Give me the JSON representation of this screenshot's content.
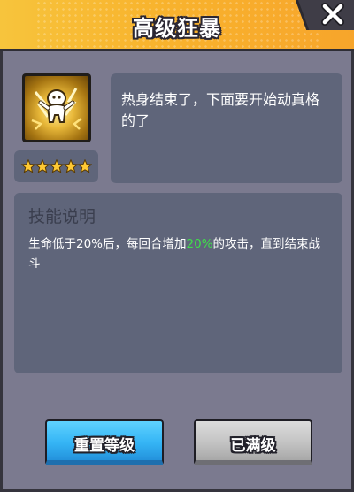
{
  "header": {
    "title": "高级狂暴"
  },
  "skill": {
    "rating_stars": 5,
    "flavor_text": "热身结束了，下面要开始动真格的了",
    "section_title": "技能说明",
    "description_before": "生命低于20%后，每回合增加",
    "description_highlight": "20%",
    "description_after": "的攻击，直到结束战斗",
    "highlight_color": "#3fe04a"
  },
  "buttons": {
    "reset_label": "重置等级",
    "maxed_label": "已满级"
  },
  "icons": {
    "close": "close-icon",
    "skill": "rage-figure-icon",
    "star": "star-icon"
  }
}
